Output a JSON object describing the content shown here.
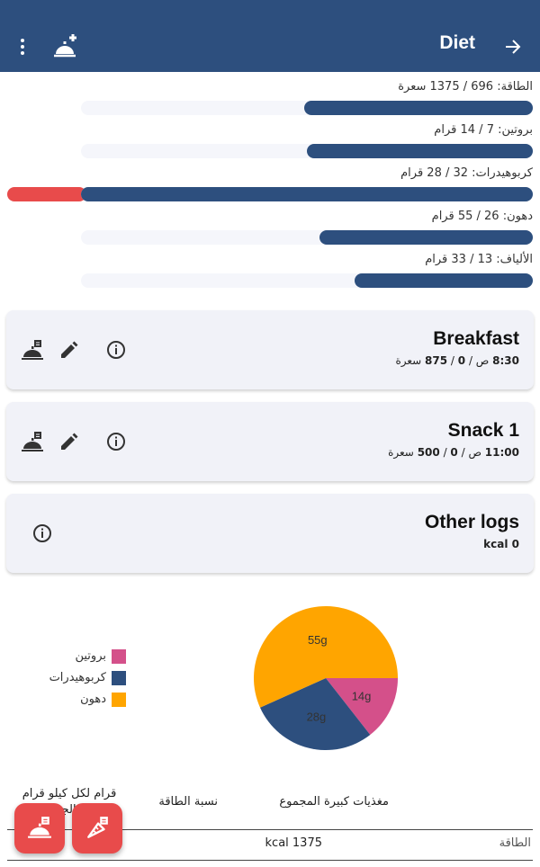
{
  "appbar": {
    "title": "Diet"
  },
  "colors": {
    "primary": "#2d4f7e",
    "over": "#e84b4b",
    "protein": "#d4508a",
    "carbs": "#2d4f7e",
    "fat": "#ffa500",
    "track": "#f5f6fb"
  },
  "bars": [
    {
      "label": "الطاقة: 696 / 1375 سعرة",
      "fraction": 0.506,
      "over_fraction": 0
    },
    {
      "label": "بروتين: 7 / 14 قرام",
      "fraction": 0.5,
      "over_fraction": 0
    },
    {
      "label": "كربوهيدرات: 32 / 28 قرام",
      "fraction": 1.0,
      "over_fraction": 0.143
    },
    {
      "label": "دهون: 26 / 55 قرام",
      "fraction": 0.473,
      "over_fraction": 0
    },
    {
      "label": "الألياف: 13 / 33 قرام",
      "fraction": 0.394,
      "over_fraction": 0
    }
  ],
  "meals": [
    {
      "title": "Breakfast",
      "time": "8:30",
      "time_suffix": "ص",
      "consumed": "0",
      "target": "875",
      "unit": "سعرة"
    },
    {
      "title": "Snack 1",
      "time": "11:00",
      "time_suffix": "ص",
      "consumed": "0",
      "target": "500",
      "unit": "سعرة"
    }
  ],
  "other_logs": {
    "title": "Other logs",
    "summary": "kcal 0"
  },
  "icons": [
    "more-vert-icon",
    "add-meal-icon",
    "arrow-forward-icon",
    "meal-log-icon",
    "edit-icon",
    "info-icon",
    "carrot-icon"
  ],
  "chart_data": {
    "type": "pie",
    "slices": [
      {
        "name": "بروتين",
        "value": 14,
        "label": "14g",
        "color": "#d4508a"
      },
      {
        "name": "كربوهيدرات",
        "value": 28,
        "label": "28g",
        "color": "#2d4f7e"
      },
      {
        "name": "دهون",
        "value": 55,
        "label": "55g",
        "color": "#ffa500"
      }
    ],
    "legend_position": "left"
  },
  "table": {
    "headers": [
      "مغذيات كبيرة المجموع",
      "نسبة الطاقة",
      "قرام لكل كيلو قرام من الجسم"
    ],
    "rows": [
      {
        "name": "الطاقة",
        "total": "kcal 1375"
      }
    ]
  }
}
